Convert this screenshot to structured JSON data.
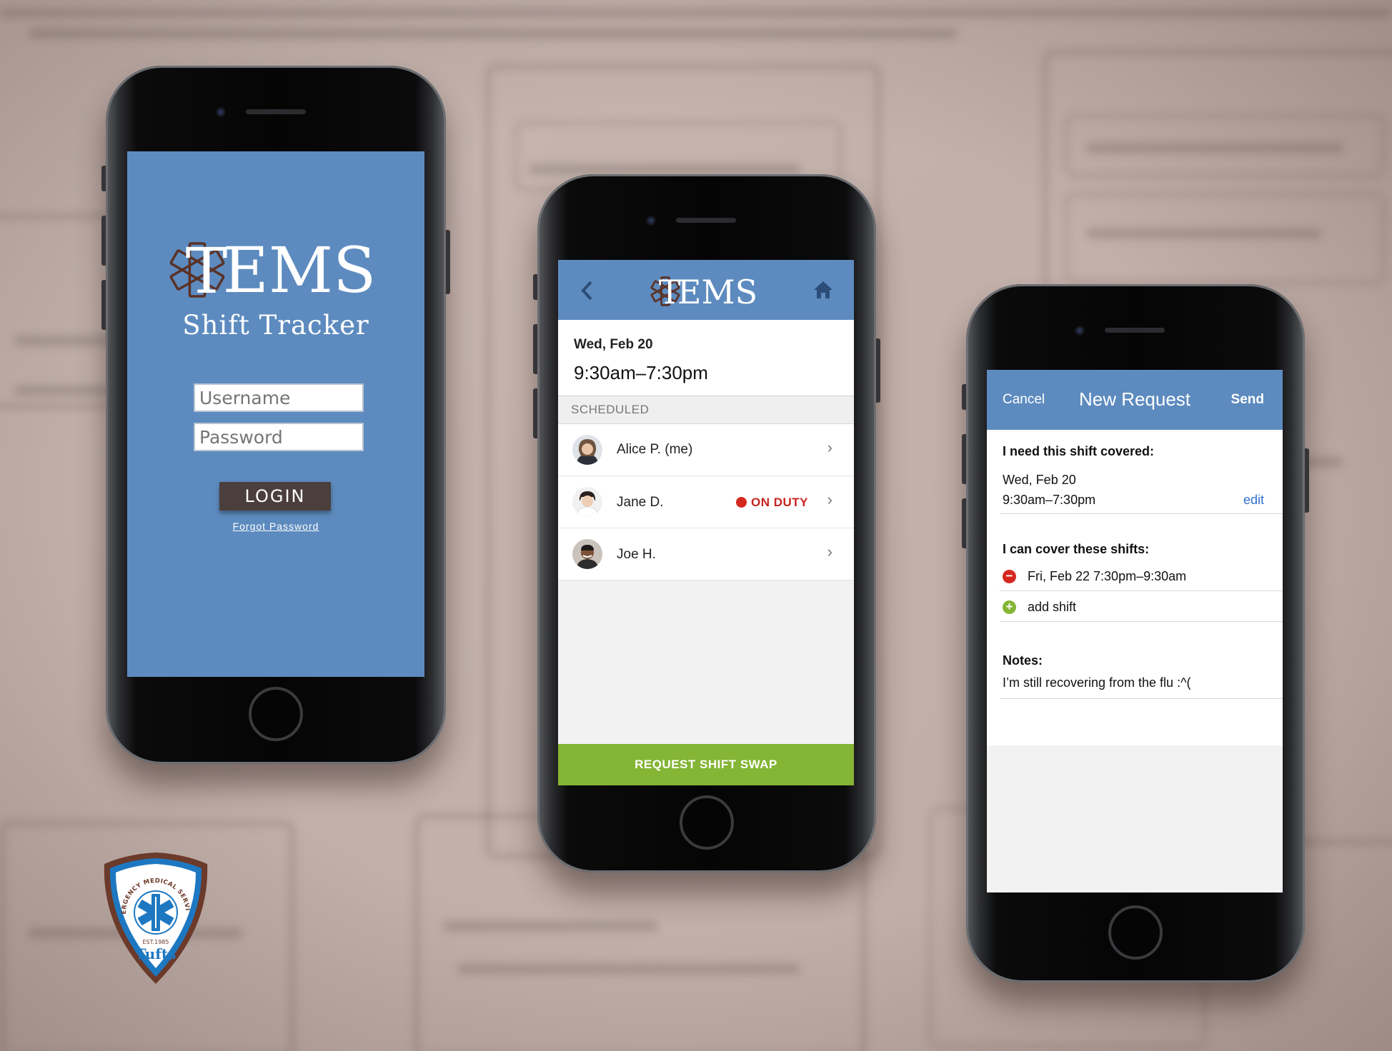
{
  "login": {
    "logo_letters": "EMS",
    "logo_t": "T",
    "subtitle": "Shift Tracker",
    "username_placeholder": "Username",
    "password_placeholder": "Password",
    "login_label": "LOGIN",
    "forgot_label": "Forgot Password"
  },
  "shift": {
    "logo_letters": "EMS",
    "logo_t": "T",
    "date": "Wed, Feb 20",
    "time": "9:30am–7:30pm",
    "section_label": "SCHEDULED",
    "people": [
      {
        "name": "Alice P. (me)",
        "status": ""
      },
      {
        "name": "Jane D.",
        "status": "ON DUTY"
      },
      {
        "name": "Joe H.",
        "status": ""
      }
    ],
    "swap_label": "REQUEST SHIFT SWAP"
  },
  "request": {
    "cancel_label": "Cancel",
    "title": "New Request",
    "send_label": "Send",
    "need_label": "I need this shift covered:",
    "need_date": "Wed, Feb 20",
    "need_time": "9:30am–7:30pm",
    "edit_label": "edit",
    "cover_label": "I can cover these shifts:",
    "cover_shift": "Fri, Feb 22 7:30pm–9:30am",
    "add_label": "add shift",
    "notes_label": "Notes:",
    "notes_text": "I’m still recovering from the flu :^("
  },
  "badge": {
    "arc_text": "EMERGENCY MEDICAL SERVICES",
    "est": "EST.1985",
    "name": "Tufts"
  },
  "colors": {
    "brand_blue": "#5d8bbf",
    "swap_green": "#84b534",
    "duty_red": "#d4281f",
    "login_button": "#4a3f3d",
    "badge_brown": "#6b3a2a"
  }
}
